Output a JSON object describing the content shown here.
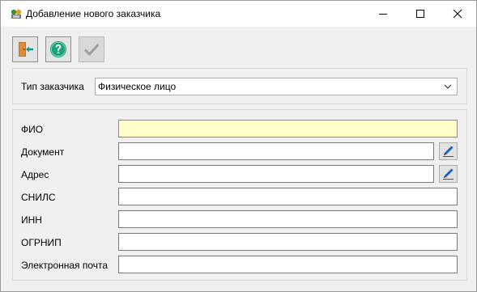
{
  "window": {
    "title": "Добавление нового заказчика"
  },
  "toolbar": {
    "buttons": [
      {
        "name": "exit",
        "icon": "exit-door-icon",
        "enabled": true
      },
      {
        "name": "help",
        "icon": "help-icon",
        "enabled": true
      },
      {
        "name": "confirm",
        "icon": "checkmark-icon",
        "enabled": false
      }
    ]
  },
  "customer_type": {
    "label": "Тип заказчика",
    "value": "Физическое лицо"
  },
  "fields": {
    "fio": {
      "label": "ФИО",
      "value": ""
    },
    "document": {
      "label": "Документ",
      "value": ""
    },
    "address": {
      "label": "Адрес",
      "value": ""
    },
    "snils": {
      "label": "СНИЛС",
      "value": ""
    },
    "inn": {
      "label": "ИНН",
      "value": ""
    },
    "ogrnip": {
      "label": "ОГРНИП",
      "value": ""
    },
    "email": {
      "label": "Электронная почта",
      "value": ""
    }
  },
  "colors": {
    "required_field_bg": "#fffec8",
    "help_icon": "#1aa37a",
    "exit_icon_arrow": "#0a9e8c",
    "edit_icon": "#1f5fbf"
  }
}
